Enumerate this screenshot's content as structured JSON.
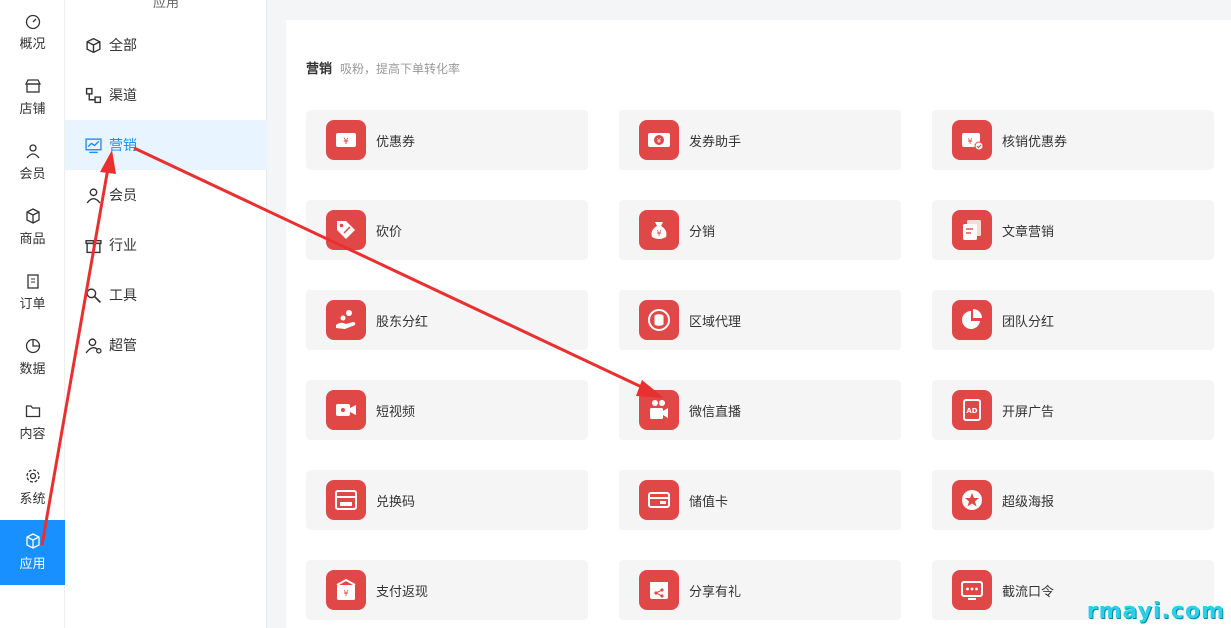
{
  "nav": {
    "items": [
      {
        "label": "概况",
        "icon": "dashboard-icon"
      },
      {
        "label": "店铺",
        "icon": "shop-icon"
      },
      {
        "label": "会员",
        "icon": "user-icon"
      },
      {
        "label": "商品",
        "icon": "box-icon"
      },
      {
        "label": "订单",
        "icon": "clipboard-icon"
      },
      {
        "label": "数据",
        "icon": "pie-chart-icon"
      },
      {
        "label": "内容",
        "icon": "folder-icon"
      },
      {
        "label": "系统",
        "icon": "gear-icon"
      },
      {
        "label": "应用",
        "icon": "cube-icon"
      }
    ],
    "active_index": 8,
    "active_color": "#1890ff"
  },
  "sub": {
    "heading": "应用",
    "items": [
      {
        "label": "全部",
        "icon": "cube-icon"
      },
      {
        "label": "渠道",
        "icon": "channel-icon"
      },
      {
        "label": "营销",
        "icon": "marketing-chart-icon"
      },
      {
        "label": "会员",
        "icon": "user-icon"
      },
      {
        "label": "行业",
        "icon": "gift-icon"
      },
      {
        "label": "工具",
        "icon": "wrench-icon"
      },
      {
        "label": "超管",
        "icon": "admin-icon"
      }
    ],
    "active_index": 2
  },
  "main": {
    "section_title": "营销",
    "section_subtitle": "吸粉，提高下单转化率",
    "tiles": [
      {
        "label": "优惠券",
        "icon": "coupon-icon"
      },
      {
        "label": "发券助手",
        "icon": "coupon-helper-icon"
      },
      {
        "label": "核销优惠券",
        "icon": "coupon-verify-icon"
      },
      {
        "label": "砍价",
        "icon": "bargain-tag-icon"
      },
      {
        "label": "分销",
        "icon": "money-bag-icon"
      },
      {
        "label": "文章营销",
        "icon": "article-icon"
      },
      {
        "label": "股东分红",
        "icon": "dividend-hand-icon"
      },
      {
        "label": "区域代理",
        "icon": "region-coins-icon"
      },
      {
        "label": "团队分红",
        "icon": "team-pie-icon"
      },
      {
        "label": "短视频",
        "icon": "video-camera-icon"
      },
      {
        "label": "微信直播",
        "icon": "live-camera-icon"
      },
      {
        "label": "开屏广告",
        "icon": "ad-icon"
      },
      {
        "label": "兑换码",
        "icon": "redeem-card-icon"
      },
      {
        "label": "储值卡",
        "icon": "stored-card-icon"
      },
      {
        "label": "超级海报",
        "icon": "poster-star-icon"
      },
      {
        "label": "支付返现",
        "icon": "cashback-icon"
      },
      {
        "label": "分享有礼",
        "icon": "share-gift-icon"
      },
      {
        "label": "截流口令",
        "icon": "password-dots-icon"
      }
    ],
    "tile_icon_color": "#e04848"
  },
  "annotation_arrow_color": "#e83030",
  "watermark": "rmayi.com"
}
